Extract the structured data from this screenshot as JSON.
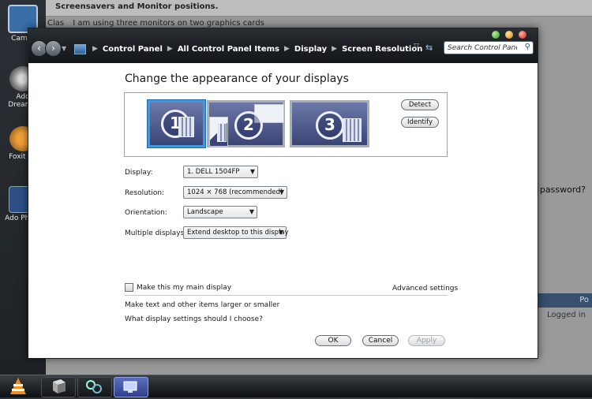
{
  "background": {
    "forum_line_1": "Screensavers and Monitor positions.",
    "forum_line_2_start": "Clas",
    "forum_line_2_rest": "I am using three monitors on two graphics cards",
    "right_snippet": "e password?",
    "right_blue": "Po",
    "right_logged": "Logged in",
    "desktop_icons": [
      "CamSt",
      "Ado Dreamw",
      "Foxit Re",
      "Ado Photo"
    ]
  },
  "window": {
    "breadcrumb": [
      "Control Panel",
      "All Control Panel Items",
      "Display",
      "Screen Resolution"
    ],
    "search_placeholder": "Search Control Panel"
  },
  "main": {
    "heading": "Change the appearance of your displays",
    "monitors": [
      "1",
      "2",
      "3"
    ],
    "detect_label": "Detect",
    "identify_label": "Identify",
    "display_label": "Display:",
    "display_value": "1. DELL 1504FP",
    "resolution_label": "Resolution:",
    "resolution_value": "1024 × 768 (recommended)",
    "orientation_label": "Orientation:",
    "orientation_value": "Landscape",
    "multiple_label": "Multiple displays:",
    "multiple_value": "Extend desktop to this display",
    "main_display_label": "Make this my main display",
    "advanced_label": "Advanced settings",
    "text_size_link": "Make text and other items larger or smaller",
    "help_link": "What display settings should I choose?",
    "ok_label": "OK",
    "cancel_label": "Cancel",
    "apply_label": "Apply"
  },
  "colors": {
    "selected_monitor_border": "#3f99dc",
    "monitor_fill": "#3a4576",
    "window_chrome": "#1c2024"
  },
  "taskbar": {
    "icons": [
      "vlc-icon",
      "package-icon",
      "network-icon",
      "display-settings-icon"
    ]
  }
}
